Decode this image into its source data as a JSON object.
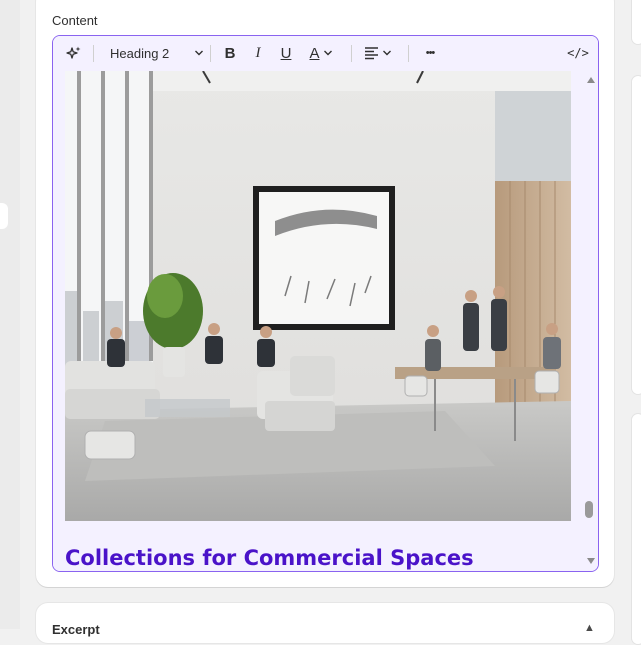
{
  "content": {
    "label": "Content"
  },
  "toolbar": {
    "ai_icon": "sparkle-icon",
    "heading_select": "Heading 2",
    "bold": "B",
    "italic": "I",
    "underline": "U",
    "text_color": "A",
    "more": "•••",
    "code": "</>"
  },
  "editor": {
    "heading_text": "Collections for Commercial Spaces",
    "heading_color": "#4a13c9",
    "border_color": "#8a63f0"
  },
  "excerpt": {
    "label": "Excerpt"
  }
}
